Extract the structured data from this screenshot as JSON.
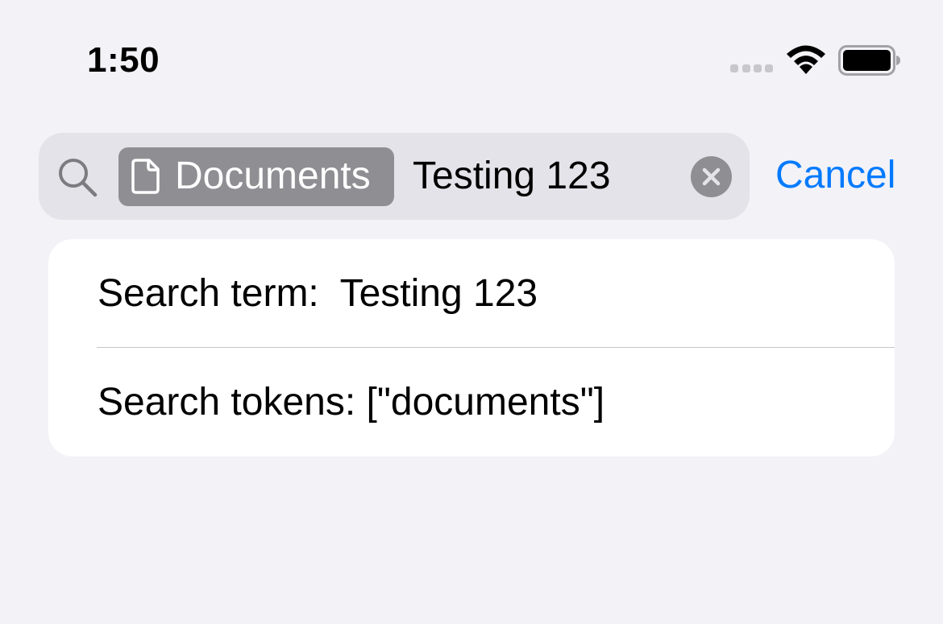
{
  "status_bar": {
    "time": "1:50",
    "icons": [
      "cellular-signal-icon",
      "wifi-icon",
      "battery-icon"
    ]
  },
  "search": {
    "token": {
      "icon": "document-icon",
      "label": "Documents"
    },
    "text": "Testing 123",
    "clear_icon": "clear-icon",
    "cancel_label": "Cancel"
  },
  "results": {
    "rows": [
      {
        "label": "Search term:",
        "value": "Testing 123"
      },
      {
        "label": "Search tokens:",
        "value": "[\"documents\"]"
      }
    ]
  },
  "colors": {
    "background": "#f2f2f7",
    "search_field": "#e3e3e9",
    "token_chip": "#8e8e93",
    "accent": "#007aff",
    "card": "#ffffff",
    "separator": "#c6c6c8"
  }
}
